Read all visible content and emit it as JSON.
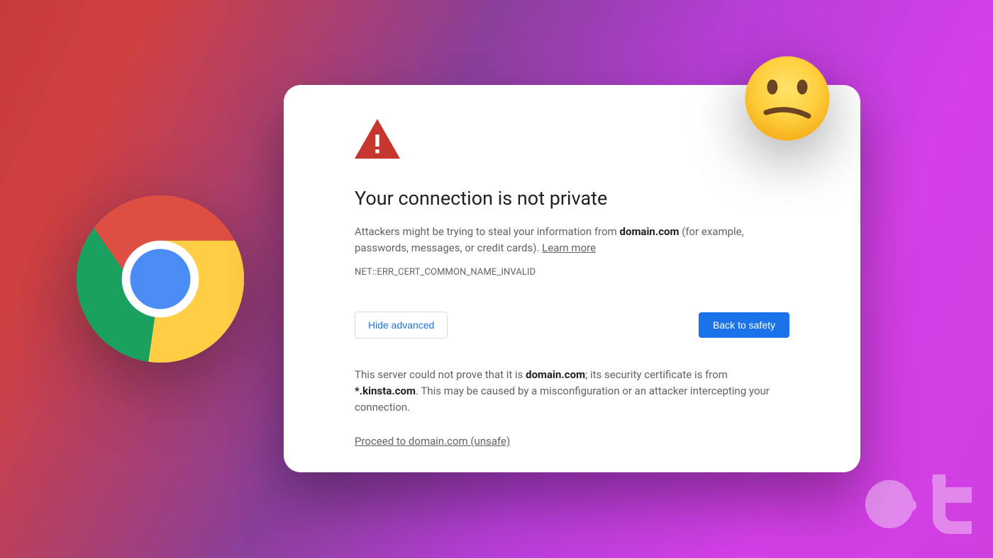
{
  "title": "Your connection is not private",
  "body": {
    "prefix": "Attackers might be trying to steal your information from ",
    "domain": "domain.com",
    "suffix": " (for example, passwords, messages, or credit cards). ",
    "learn_more": "Learn more"
  },
  "error_code": "NET::ERR_CERT_COMMON_NAME_INVALID",
  "buttons": {
    "hide_advanced": "Hide advanced",
    "back_to_safety": "Back to safety"
  },
  "advanced": {
    "p1_prefix": "This server could not prove that it is ",
    "p1_domain": "domain.com",
    "p1_mid": "; its security certificate is from ",
    "p1_cert": "*.kinsta.com",
    "p1_suffix": ". This may be caused by a misconfiguration or an attacker intercepting your connection.",
    "proceed": "Proceed to domain.com (unsafe)"
  },
  "colors": {
    "danger": "#c5372c",
    "primary": "#1a73e8"
  }
}
